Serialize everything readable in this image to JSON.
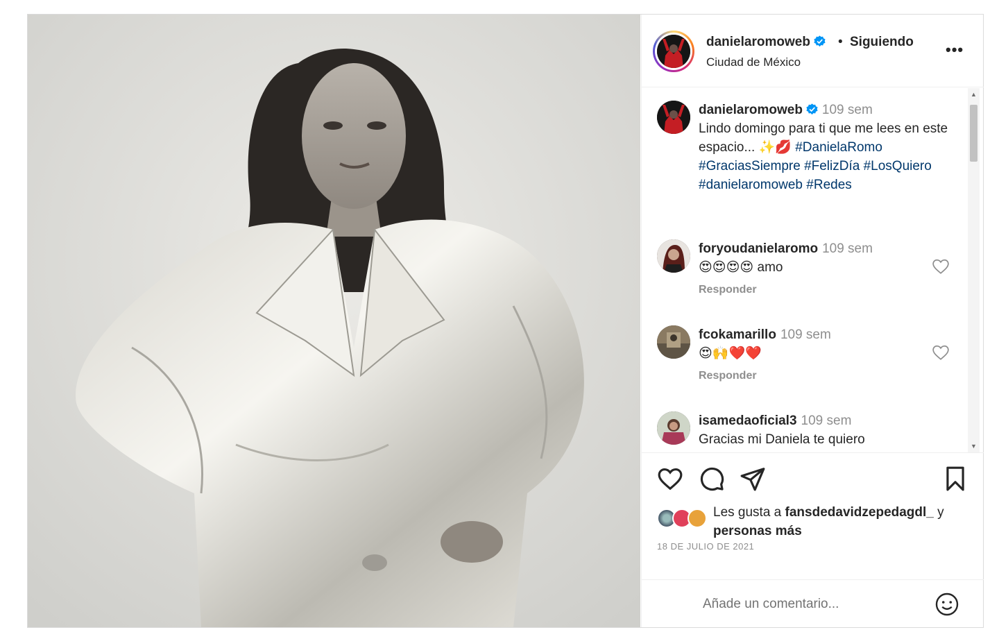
{
  "header": {
    "username": "danielaromoweb",
    "separator": "•",
    "follow_state": "Siguiendo",
    "location": "Ciudad de México",
    "more_label": "•••"
  },
  "caption": {
    "username": "danielaromoweb",
    "time": "109 sem",
    "text": "Lindo domingo para ti que me lees en este espacio... ",
    "emojis": "✨💋",
    "hashtags": [
      "#DanielaRomo",
      "#GraciasSiempre",
      "#FelizDía",
      "#LosQuiero",
      "#danielaromoweb",
      "#Redes"
    ]
  },
  "comments": [
    {
      "username": "foryoudanielaromo",
      "time": "109 sem",
      "text": "😍😍😍😍 amo",
      "reply_label": "Responder"
    },
    {
      "username": "fcokamarillo",
      "time": "109 sem",
      "text": "😍🙌❤️❤️",
      "reply_label": "Responder"
    },
    {
      "username": "isamedaoficial3",
      "time": "109 sem",
      "text": "Gracias mi Daniela te quiero"
    }
  ],
  "likes": {
    "prefix": "Les gusta a ",
    "user": "fansdedavidzepedagdl_",
    "suffix": " y",
    "others": "personas más"
  },
  "date": "18 DE JULIO DE 2021",
  "comment_input": {
    "placeholder": "Añade un comentario..."
  },
  "colors": {
    "link": "#00376b",
    "muted": "#8e8e8e",
    "verified": "#0095f6",
    "text": "#262626"
  }
}
